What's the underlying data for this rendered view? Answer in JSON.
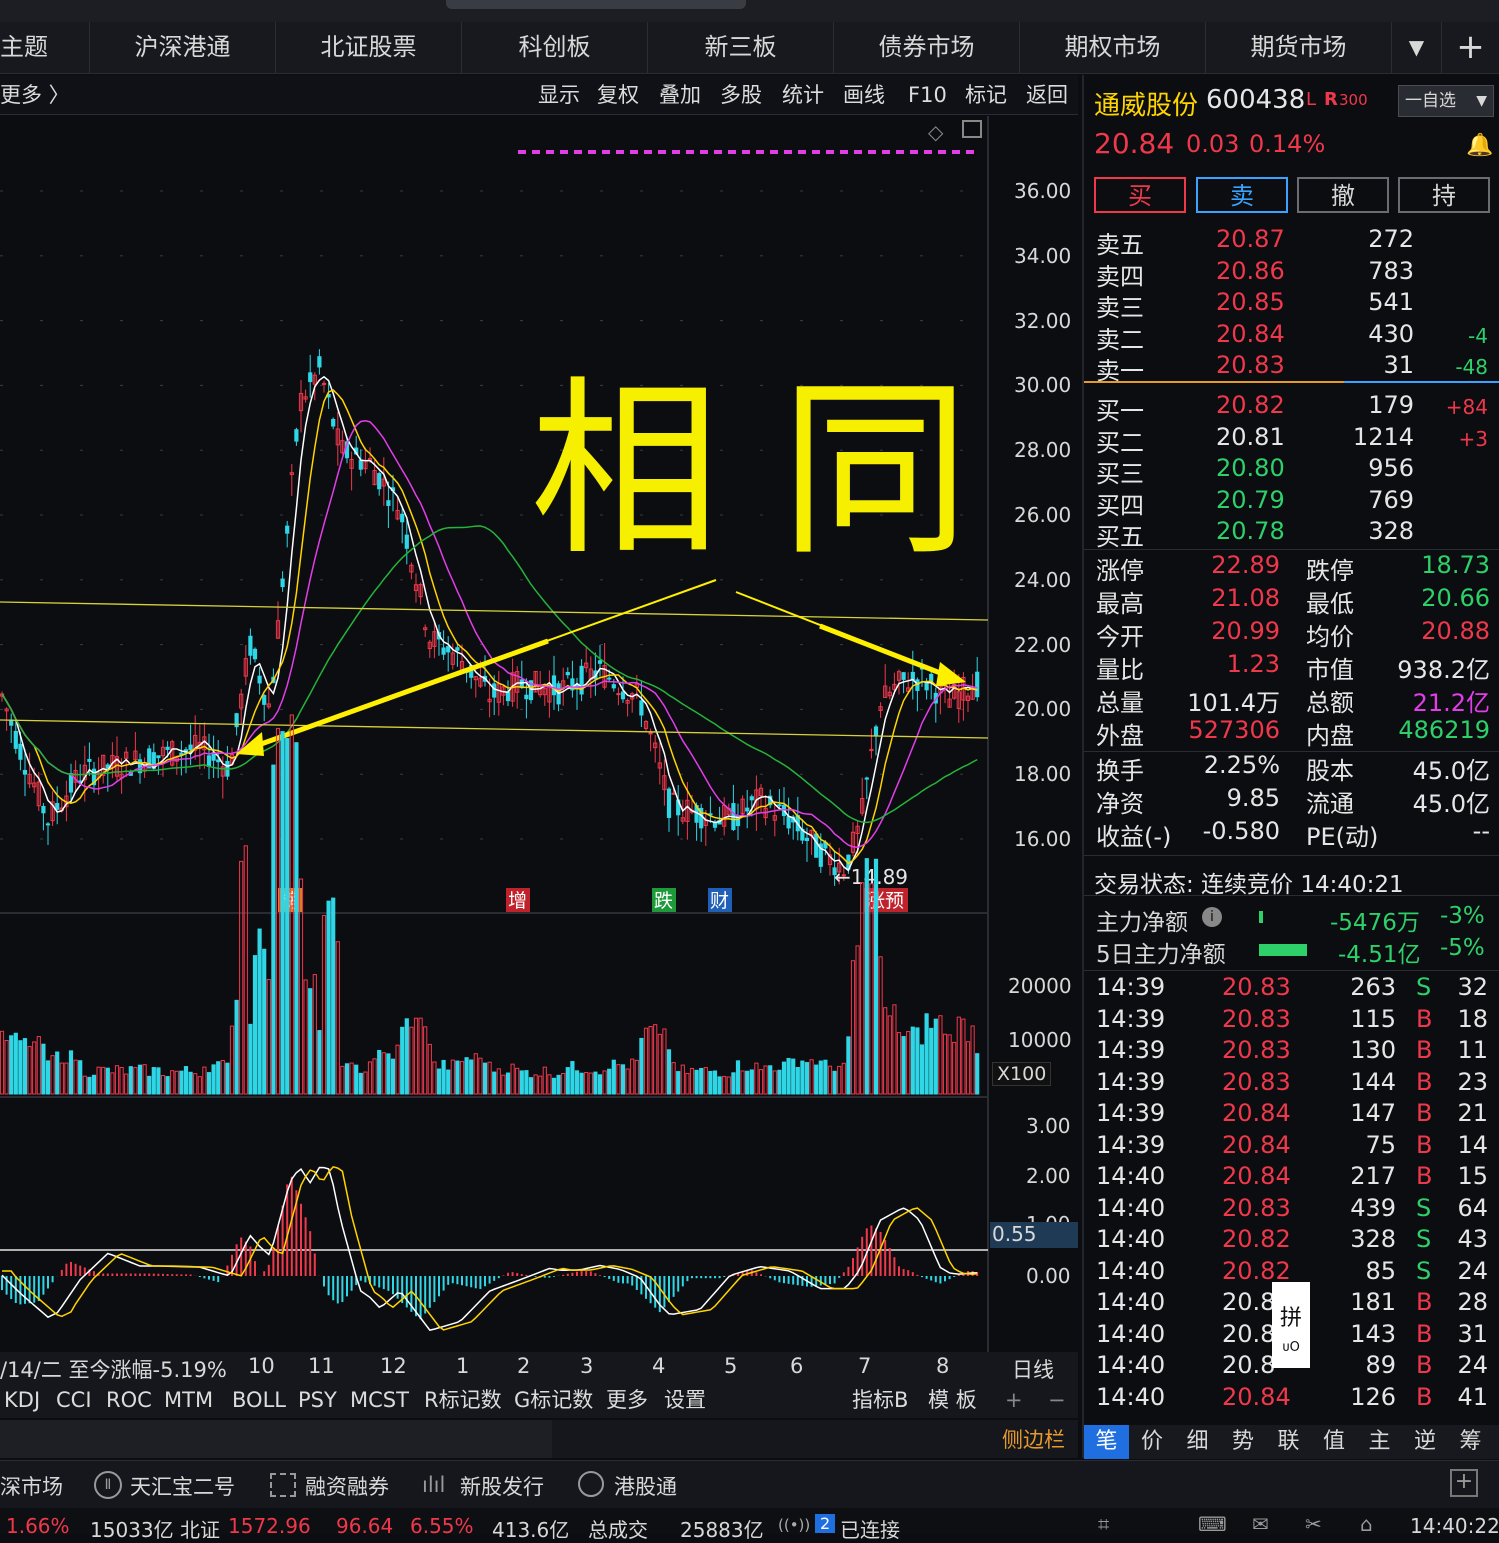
{
  "nav": {
    "tabs": [
      "主题",
      "沪深港通",
      "北证股票",
      "科创板",
      "新三板",
      "债券市场",
      "期权市场",
      "期货市场"
    ],
    "dropdown": "▼",
    "add": "+"
  },
  "toolbar": {
    "more": "更多 〉",
    "buttons": [
      "显示",
      "复权",
      "叠加",
      "多股",
      "统计",
      "画线",
      "F10",
      "标记",
      "返回"
    ]
  },
  "chart": {
    "price_axis": [
      "36.00",
      "34.00",
      "32.00",
      "30.00",
      "28.00",
      "26.00",
      "24.00",
      "22.00",
      "20.00",
      "18.00",
      "16.00"
    ],
    "low_marker": "←14.89",
    "event_tags": [
      {
        "label": "榜",
        "color": "#d98020"
      },
      {
        "label": "增",
        "color": "#c0222c"
      },
      {
        "label": "跌",
        "color": "#1e9a3a"
      },
      {
        "label": "财",
        "color": "#1f5fb8"
      },
      {
        "label": "涨预",
        "color": "#c0222c"
      }
    ],
    "handwritten": "相同",
    "volume_axis": [
      "20000",
      "10000"
    ],
    "volume_unit": "X100",
    "macd_axis": [
      "3.00",
      "2.00",
      "0.00"
    ],
    "macd_current": "0.55",
    "macd_partial": "1.00",
    "date_axis": [
      "10",
      "11",
      "12",
      "1",
      "2",
      "3",
      "4",
      "5",
      "6",
      "7",
      "8"
    ],
    "range_label": "/14/二  至今涨幅-5.19%",
    "period": "日线"
  },
  "indicators": {
    "items": [
      "KDJ",
      "CCI",
      "ROC",
      "MTM",
      "BOLL",
      "PSY",
      "MCST",
      "R标记数",
      "G标记数",
      "更多",
      "设置"
    ],
    "right": [
      "指标B",
      "模 板"
    ],
    "plus": "+",
    "minus": "−"
  },
  "sidebar_label": "侧边栏",
  "stock": {
    "name": "通威股份",
    "code": "600438",
    "flags_l": "L",
    "flags_r": "R",
    "flags_num": "300",
    "watch_btn": "一自选",
    "price": "20.84",
    "change": "0.03",
    "change_pct": "0.14%",
    "trade_buttons": [
      "买",
      "卖",
      "撤",
      "持"
    ]
  },
  "orderbook": {
    "asks": [
      {
        "label": "卖五",
        "price": "20.87",
        "vol": "272",
        "chg": ""
      },
      {
        "label": "卖四",
        "price": "20.86",
        "vol": "783",
        "chg": ""
      },
      {
        "label": "卖三",
        "price": "20.85",
        "vol": "541",
        "chg": ""
      },
      {
        "label": "卖二",
        "price": "20.84",
        "vol": "430",
        "chg": "-4"
      },
      {
        "label": "卖一",
        "price": "20.83",
        "vol": "31",
        "chg": "-48"
      }
    ],
    "bids": [
      {
        "label": "买一",
        "price": "20.82",
        "vol": "179",
        "chg": "+84"
      },
      {
        "label": "买二",
        "price": "20.81",
        "vol": "1214",
        "chg": "+3"
      },
      {
        "label": "买三",
        "price": "20.80",
        "vol": "956",
        "chg": ""
      },
      {
        "label": "买四",
        "price": "20.79",
        "vol": "769",
        "chg": ""
      },
      {
        "label": "买五",
        "price": "20.78",
        "vol": "328",
        "chg": ""
      }
    ]
  },
  "stats": [
    {
      "l1": "涨停",
      "v1": "22.89",
      "c1": "red",
      "l2": "跌停",
      "v2": "18.73",
      "c2": "green"
    },
    {
      "l1": "最高",
      "v1": "21.08",
      "c1": "red",
      "l2": "最低",
      "v2": "20.66",
      "c2": "green"
    },
    {
      "l1": "今开",
      "v1": "20.99",
      "c1": "red",
      "l2": "均价",
      "v2": "20.88",
      "c2": "red"
    },
    {
      "l1": "量比",
      "v1": "1.23",
      "c1": "red",
      "l2": "市值",
      "v2": "938.2亿",
      "c2": "white"
    },
    {
      "l1": "总量",
      "v1": "101.4万",
      "c1": "white",
      "l2": "总额",
      "v2": "21.2亿",
      "c2": "mag"
    },
    {
      "l1": "外盘",
      "v1": "527306",
      "c1": "red",
      "l2": "内盘",
      "v2": "486219",
      "c2": "green"
    }
  ],
  "stats2": [
    {
      "l1": "换手",
      "v1": "2.25%",
      "l2": "股本",
      "v2": "45.0亿"
    },
    {
      "l1": "净资",
      "v1": "9.85",
      "l2": "流通",
      "v2": "45.0亿"
    },
    {
      "l1": "收益(-)",
      "v1": "-0.580",
      "l2": "PE(动)",
      "v2": "--"
    }
  ],
  "status": {
    "label": "交易状态: 连续竞价 14:40:21",
    "main_net_label": "主力净额",
    "main_net_val": "-5476万",
    "main_net_pct": "-3%",
    "five_day_label": "5日主力净额",
    "five_day_val": "-4.51亿",
    "five_day_pct": "-5%"
  },
  "ticks": [
    {
      "t": "14:39",
      "p": "20.83",
      "v": "263",
      "s": "S",
      "n": "32"
    },
    {
      "t": "14:39",
      "p": "20.83",
      "v": "115",
      "s": "B",
      "n": "18"
    },
    {
      "t": "14:39",
      "p": "20.83",
      "v": "130",
      "s": "B",
      "n": "11"
    },
    {
      "t": "14:39",
      "p": "20.83",
      "v": "144",
      "s": "B",
      "n": "23"
    },
    {
      "t": "14:39",
      "p": "20.84",
      "v": "147",
      "s": "B",
      "n": "21"
    },
    {
      "t": "14:39",
      "p": "20.84",
      "v": "75",
      "s": "B",
      "n": "14"
    },
    {
      "t": "14:40",
      "p": "20.84",
      "v": "217",
      "s": "B",
      "n": "15"
    },
    {
      "t": "14:40",
      "p": "20.83",
      "v": "439",
      "s": "S",
      "n": "64"
    },
    {
      "t": "14:40",
      "p": "20.82",
      "v": "328",
      "s": "S",
      "n": "43"
    },
    {
      "t": "14:40",
      "p": "20.82",
      "v": "85",
      "s": "S",
      "n": "24"
    },
    {
      "t": "14:40",
      "p": "20.8",
      "v": "181",
      "s": "B",
      "n": "28"
    },
    {
      "t": "14:40",
      "p": "20.8",
      "v": "143",
      "s": "B",
      "n": "31"
    },
    {
      "t": "14:40",
      "p": "20.8",
      "v": "89",
      "s": "B",
      "n": "24"
    },
    {
      "t": "14:40",
      "p": "20.84",
      "v": "126",
      "s": "B",
      "n": "41"
    }
  ],
  "ime_popup": {
    "char": "拼",
    "sub": "ᴜO"
  },
  "right_tabs": [
    "笔",
    "价",
    "细",
    "势",
    "联",
    "值",
    "主",
    "逆",
    "筹"
  ],
  "bottom": {
    "items": [
      "深市场",
      "天汇宝二号",
      "融资融券",
      "新股发行",
      "港股通"
    ]
  },
  "statusbar": {
    "text1": "1.66%",
    "text2": "15033亿 北证",
    "text3": "1572.96",
    "text4": "96.64",
    "text5": "6.55%",
    "text6": "413.6亿",
    "text7": "总成交",
    "text8": "25883亿",
    "conn_num": "2",
    "conn": "已连接",
    "time": "14:40:22"
  },
  "colors": {
    "up": "#f0384b",
    "down": "#2ed6e6",
    "ma5": "#ffffff",
    "ma10": "#ffd400",
    "ma20": "#e23ee8",
    "ma60": "#25b33a",
    "accent": "#ffef00"
  }
}
